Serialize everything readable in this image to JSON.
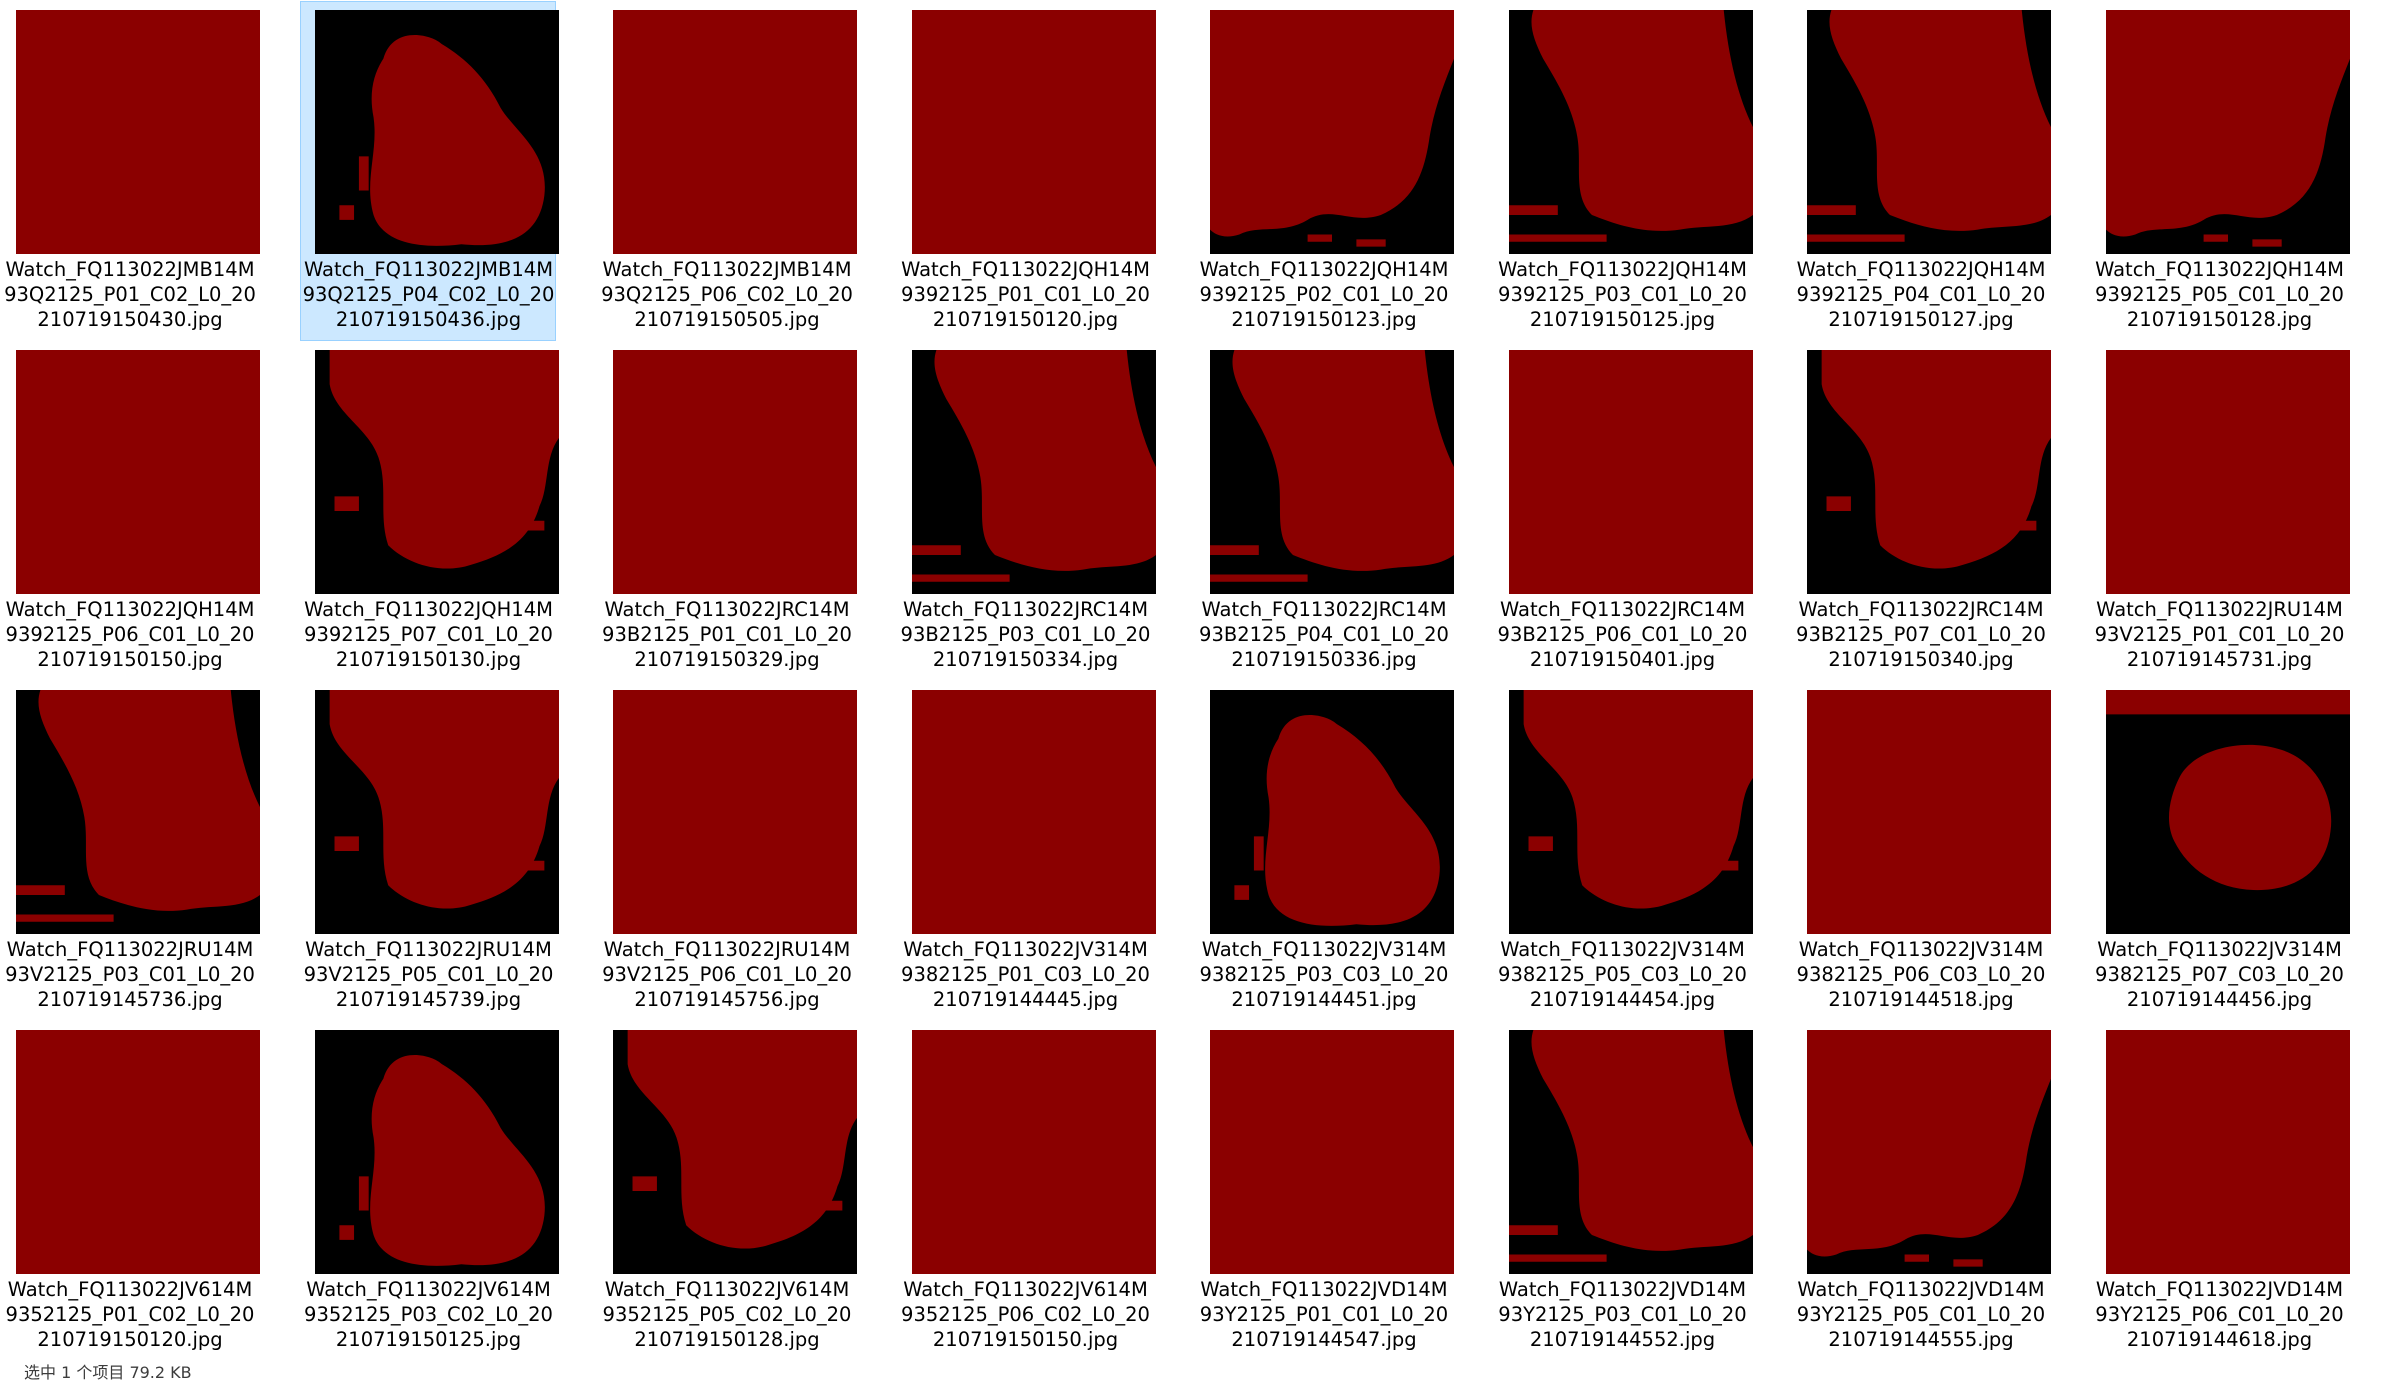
{
  "colors": {
    "mask_foreground": "#8b0000",
    "mask_background": "#000000",
    "selection_fill": "#cce8ff",
    "selection_border": "#99d1ff"
  },
  "files": [
    {
      "name": "Watch_FQ113022JMB14M93Q2125_P01_C02_L0_20210719150430.jpg",
      "selected": false,
      "mask": "full"
    },
    {
      "name": "Watch_FQ113022JMB14M93Q2125_P04_C02_L0_20210719150436.jpg",
      "selected": true,
      "mask": "blob_small"
    },
    {
      "name": "Watch_FQ113022JMB14M93Q2125_P06_C02_L0_20210719150505.jpg",
      "selected": false,
      "mask": "full"
    },
    {
      "name": "Watch_FQ113022JQH14M9392125_P01_C01_L0_20210719150120.jpg",
      "selected": false,
      "mask": "full"
    },
    {
      "name": "Watch_FQ113022JQH14M9392125_P02_C01_L0_20210719150123.jpg",
      "selected": false,
      "mask": "blob_left"
    },
    {
      "name": "Watch_FQ113022JQH14M9392125_P03_C01_L0_20210719150125.jpg",
      "selected": false,
      "mask": "blob_diag"
    },
    {
      "name": "Watch_FQ113022JQH14M9392125_P04_C01_L0_20210719150127.jpg",
      "selected": false,
      "mask": "blob_diag"
    },
    {
      "name": "Watch_FQ113022JQH14M9392125_P05_C01_L0_20210719150128.jpg",
      "selected": false,
      "mask": "blob_left"
    },
    {
      "name": "Watch_FQ113022JQH14M9392125_P06_C01_L0_20210719150150.jpg",
      "selected": false,
      "mask": "full"
    },
    {
      "name": "Watch_FQ113022JQH14M9392125_P07_C01_L0_20210719150130.jpg",
      "selected": false,
      "mask": "blob_center"
    },
    {
      "name": "Watch_FQ113022JRC14M93B2125_P01_C01_L0_20210719150329.jpg",
      "selected": false,
      "mask": "full"
    },
    {
      "name": "Watch_FQ113022JRC14M93B2125_P03_C01_L0_20210719150334.jpg",
      "selected": false,
      "mask": "blob_diag"
    },
    {
      "name": "Watch_FQ113022JRC14M93B2125_P04_C01_L0_20210719150336.jpg",
      "selected": false,
      "mask": "blob_diag"
    },
    {
      "name": "Watch_FQ113022JRC14M93B2125_P06_C01_L0_20210719150401.jpg",
      "selected": false,
      "mask": "full"
    },
    {
      "name": "Watch_FQ113022JRC14M93B2125_P07_C01_L0_20210719150340.jpg",
      "selected": false,
      "mask": "blob_center"
    },
    {
      "name": "Watch_FQ113022JRU14M93V2125_P01_C01_L0_20210719145731.jpg",
      "selected": false,
      "mask": "full"
    },
    {
      "name": "Watch_FQ113022JRU14M93V2125_P03_C01_L0_20210719145736.jpg",
      "selected": false,
      "mask": "blob_diag"
    },
    {
      "name": "Watch_FQ113022JRU14M93V2125_P05_C01_L0_20210719145739.jpg",
      "selected": false,
      "mask": "blob_center"
    },
    {
      "name": "Watch_FQ113022JRU14M93V2125_P06_C01_L0_20210719145756.jpg",
      "selected": false,
      "mask": "full"
    },
    {
      "name": "Watch_FQ113022JV314M9382125_P01_C03_L0_20210719144445.jpg",
      "selected": false,
      "mask": "full"
    },
    {
      "name": "Watch_FQ113022JV314M9382125_P03_C03_L0_20210719144451.jpg",
      "selected": false,
      "mask": "blob_small"
    },
    {
      "name": "Watch_FQ113022JV314M9382125_P05_C03_L0_20210719144454.jpg",
      "selected": false,
      "mask": "blob_center"
    },
    {
      "name": "Watch_FQ113022JV314M9382125_P06_C03_L0_20210719144518.jpg",
      "selected": false,
      "mask": "full"
    },
    {
      "name": "Watch_FQ113022JV314M9382125_P07_C03_L0_20210719144456.jpg",
      "selected": false,
      "mask": "blob_round"
    },
    {
      "name": "Watch_FQ113022JV614M9352125_P01_C02_L0_20210719150120.jpg",
      "selected": false,
      "mask": "full"
    },
    {
      "name": "Watch_FQ113022JV614M9352125_P03_C02_L0_20210719150125.jpg",
      "selected": false,
      "mask": "blob_small"
    },
    {
      "name": "Watch_FQ113022JV614M9352125_P05_C02_L0_20210719150128.jpg",
      "selected": false,
      "mask": "blob_center"
    },
    {
      "name": "Watch_FQ113022JV614M9352125_P06_C02_L0_20210719150150.jpg",
      "selected": false,
      "mask": "full"
    },
    {
      "name": "Watch_FQ113022JVD14M93Y2125_P01_C01_L0_20210719144547.jpg",
      "selected": false,
      "mask": "full"
    },
    {
      "name": "Watch_FQ113022JVD14M93Y2125_P03_C01_L0_20210719144552.jpg",
      "selected": false,
      "mask": "blob_diag"
    },
    {
      "name": "Watch_FQ113022JVD14M93Y2125_P05_C01_L0_20210719144555.jpg",
      "selected": false,
      "mask": "blob_left"
    },
    {
      "name": "Watch_FQ113022JVD14M93Y2125_P06_C01_L0_20210719144618.jpg",
      "selected": false,
      "mask": "full"
    }
  ],
  "status": {
    "text": "选中 1 个项目 79.2 KB"
  }
}
